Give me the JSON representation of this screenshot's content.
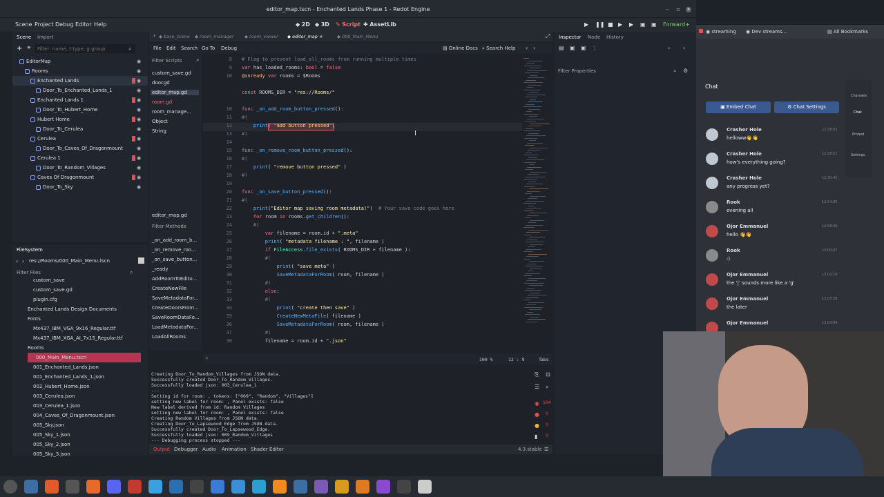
{
  "window": {
    "title": "editor_map.tscn - Enchanted Lands Phase 1 - Redot Engine"
  },
  "menu": [
    "Scene",
    "Project",
    "Debug",
    "Editor",
    "Help"
  ],
  "workspaces": [
    "2D",
    "3D",
    "Script",
    "AssetLib"
  ],
  "renderer": "Forward+",
  "scene_dock": {
    "tabs": [
      "Scene",
      "Import"
    ],
    "filter_placeholder": "Filter: name, t:type, g:group",
    "items": [
      {
        "label": "EditorMap",
        "color": "#8da5f3"
      },
      {
        "label": "Rooms",
        "color": "#8da5f3"
      },
      {
        "label": "Enchanted Lands",
        "color": "#8da5f3"
      },
      {
        "label": "Door_To_Enchanted_Lands_1",
        "color": "#8da5f3"
      },
      {
        "label": "Enchanted Lands 1",
        "color": "#8da5f3"
      },
      {
        "label": "Door_To_Hubert_Home",
        "color": "#8da5f3"
      },
      {
        "label": "Hubert Home",
        "color": "#8da5f3"
      },
      {
        "label": "Door_To_Cerulea",
        "color": "#8da5f3"
      },
      {
        "label": "Cerulea",
        "color": "#8da5f3"
      },
      {
        "label": "Door_To_Caves_Of_Dragonmount",
        "color": "#8da5f3"
      },
      {
        "label": "Cerulea 1",
        "color": "#8da5f3"
      },
      {
        "label": "Door_To_Random_Villages",
        "color": "#8da5f3"
      },
      {
        "label": "Caves Of Dragonmount",
        "color": "#8da5f3"
      },
      {
        "label": "Door_To_Sky",
        "color": "#8da5f3"
      }
    ]
  },
  "filesystem": {
    "title": "FileSystem",
    "path": "res://Rooms/000_Main_Menu.tscn",
    "filter_placeholder": "Filter Files",
    "items": [
      "custom_save",
      "custom_save.gd",
      "plugin.cfg",
      "Enchanted Lands Design Documents",
      "Fonts",
      "Mx437_IBM_VGA_9x16_Regular.ttf",
      "Mx437_IBM_XGA_AI_7x15_Regular.ttf",
      "Rooms",
      "000_Main_Menu.tscn",
      "001_Enchanted_Lands.json",
      "001_Enchanted_Lands_1.json",
      "002_Hubert_Home.json",
      "003_Cerulea.json",
      "003_Cerulea_1.json",
      "004_Caves_Of_Dragonmount.json",
      "005_Sky.json",
      "005_Sky_1.json",
      "005_Sky_2.json",
      "005_Sky_3.json"
    ]
  },
  "script_tabs": [
    "base_scene",
    "room_manager",
    "room_viewer",
    "editor_map",
    "000_Main_Menu"
  ],
  "script_menu": [
    "File",
    "Edit",
    "Search",
    "Go To",
    "Debug"
  ],
  "script_links": [
    "Online Docs",
    "Search Help"
  ],
  "scripts_panel": {
    "filter_placeholder": "Filter Scripts",
    "items": [
      "custom_save.gd",
      "doocgd",
      "editor_map.gd",
      "room.gd",
      "room_manage...",
      "Object",
      "String"
    ],
    "current": "editor_map.gd",
    "methods_placeholder": "Filter Methods",
    "methods": [
      "_on_add_room_b...",
      "_on_remove_roo...",
      "_on_save_button...",
      "_ready",
      "AddRoomToEdito...",
      "CreateNewFile",
      "SaveMetadataFor...",
      "CreateDoorsFrom...",
      "SaveRoomDataFo...",
      "LoadMetadataFor...",
      "LoadAllRooms"
    ]
  },
  "code": {
    "lines": [
      {
        "n": "8",
        "t": "# Flag to prevent load_all_rooms from running multiple times"
      },
      {
        "n": "9",
        "t": "var has_loaded_rooms: bool = false"
      },
      {
        "n": "10",
        "t": "@onready var rooms = $Rooms"
      },
      {
        "n": "",
        "t": ""
      },
      {
        "n": "",
        "t": "const ROOMS_DIR = \"res://Rooms/\""
      },
      {
        "n": "",
        "t": ""
      },
      {
        "n": "10",
        "t": "func _on_add_room_button_pressed():"
      },
      {
        "n": "11",
        "t": "#("
      },
      {
        "n": "12",
        "t": "    print( \"add button pressed\")"
      },
      {
        "n": "13",
        "t": "#)"
      },
      {
        "n": "14",
        "t": ""
      },
      {
        "n": "15",
        "t": "func _on_remove_room_button_pressed():"
      },
      {
        "n": "16",
        "t": "#("
      },
      {
        "n": "17",
        "t": "    print( \"remove button pressed\" )"
      },
      {
        "n": "18",
        "t": "#)"
      },
      {
        "n": "19",
        "t": ""
      },
      {
        "n": "20",
        "t": "func _on_save_button_pressed():"
      },
      {
        "n": "21",
        "t": "#("
      },
      {
        "n": "22",
        "t": "    print(\"Editor map saving room metadata!\")  # Your save code goes here"
      },
      {
        "n": "23",
        "t": "    for room in rooms.get_children():"
      },
      {
        "n": "24",
        "t": "    #("
      },
      {
        "n": "25",
        "t": "        var filename = room.id + \".meta\""
      },
      {
        "n": "26",
        "t": "        print( \"metadata filename : \", filename )"
      },
      {
        "n": "27",
        "t": "        if FileAccess.file_exists( ROOMS_DIR + filename ):"
      },
      {
        "n": "28",
        "t": "        #("
      },
      {
        "n": "29",
        "t": "            print( \"save meta\" )"
      },
      {
        "n": "30",
        "t": "            SaveMetadataForRoom( room, filename )"
      },
      {
        "n": "31",
        "t": "        #)"
      },
      {
        "n": "32",
        "t": "        else:"
      },
      {
        "n": "33",
        "t": "        #("
      },
      {
        "n": "34",
        "t": "            print( \"create then save\" )"
      },
      {
        "n": "35",
        "t": "            CreateNewMetaFile( filename )"
      },
      {
        "n": "36",
        "t": "            SaveMetadataForRoom( room, filename )"
      },
      {
        "n": "37",
        "t": "        #)"
      },
      {
        "n": "38",
        "t": "        filename = room.id + \".json\""
      }
    ],
    "zoom": "100 %",
    "cursor": "12 :   9",
    "indent": "Tabs"
  },
  "output": [
    "Creating Door_To_Random_Villages from JSON data.",
    "Successfully created Door_To_Random_Villages.",
    "Successfully loaded json: 003_Cerulea_1",
    "---",
    "Setting id for room: , tokens: [\"009\", \"Random\", \"Villages\"]",
    "setting new label for room: , Panel exists: false",
    "New label derived from id: Random Villages",
    "setting new label for room: , Panel exists: false",
    "Creating Random Villages from JSON data.",
    "Creating Door_To_Lapsewood_Edge from JSON data.",
    "Successfully created Door_To_Lapsewood_Edge.",
    "Successfully loaded json: 009_Random_Villages",
    "--- Debugging process stopped ---"
  ],
  "bottom_tabs": [
    "Output",
    "Debugger",
    "Audio",
    "Animation",
    "Shader Editor"
  ],
  "version": "4.3.stable",
  "inspector": {
    "tabs": [
      "Inspector",
      "Node",
      "History"
    ],
    "filter_placeholder": "Filter Properties"
  },
  "browser": {
    "bookmarks": [
      "streaming",
      "Dev streams...",
      "All Bookmarks"
    ],
    "chat_title": "Chat",
    "embed_btn": "Embed Chat",
    "settings_btn": "Chat Settings",
    "side": [
      "Channels",
      "Chat",
      "Embed",
      "Settings"
    ],
    "messages": [
      {
        "name": "Crasher Hole",
        "text": "helloww👋👋",
        "time": "12:28:01"
      },
      {
        "name": "Crasher Hole",
        "text": "how's everything going?",
        "time": "12:28:51"
      },
      {
        "name": "Crasher Hole",
        "text": "any progress yet?",
        "time": "12:30:42"
      },
      {
        "name": "Rook",
        "text": "evening all",
        "time": "12:54:05"
      },
      {
        "name": "Ojor Emmanuel",
        "text": "hello 👋👋",
        "time": "12:58:06"
      },
      {
        "name": "Rook",
        "text": ":)",
        "time": "13:00:47"
      },
      {
        "name": "Ojor Emmanuel",
        "text": "the '|' sounds more like a 'g'",
        "time": "13:02:18"
      },
      {
        "name": "Ojor Emmanuel",
        "text": "the later",
        "time": "13:03:28"
      },
      {
        "name": "Ojor Emmanuel",
        "text": "",
        "time": "13:04:08"
      }
    ]
  },
  "colors": {
    "accent": "#478cbf",
    "script_red": "#ff5f5f",
    "selected": "#e04b63"
  }
}
